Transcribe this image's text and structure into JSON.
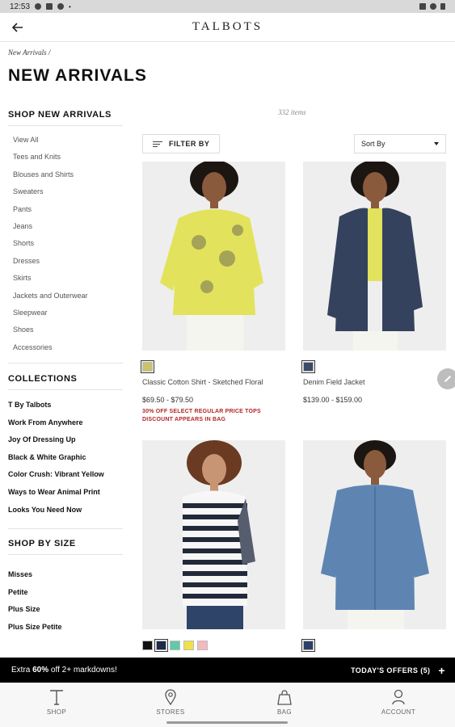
{
  "status_bar": {
    "time": "12:53"
  },
  "header": {
    "logo": "TALBOTS"
  },
  "breadcrumb": {
    "text": "New Arrivals /"
  },
  "page": {
    "title": "NEW ARRIVALS"
  },
  "sidebar": {
    "shop_heading": "SHOP NEW ARRIVALS",
    "shop_items": [
      {
        "label": "View All"
      },
      {
        "label": "Tees and Knits"
      },
      {
        "label": "Blouses and Shirts"
      },
      {
        "label": "Sweaters"
      },
      {
        "label": "Pants"
      },
      {
        "label": "Jeans"
      },
      {
        "label": "Shorts"
      },
      {
        "label": "Dresses"
      },
      {
        "label": "Skirts"
      },
      {
        "label": "Jackets and Outerwear"
      },
      {
        "label": "Sleepwear"
      },
      {
        "label": "Shoes"
      },
      {
        "label": "Accessories"
      }
    ],
    "collections_heading": "COLLECTIONS",
    "collections": [
      {
        "label": "T By Talbots"
      },
      {
        "label": "Work From Anywhere"
      },
      {
        "label": "Joy Of Dressing Up"
      },
      {
        "label": "Black & White Graphic"
      },
      {
        "label": "Color Crush: Vibrant Yellow"
      },
      {
        "label": "Ways to Wear Animal Print"
      },
      {
        "label": "Looks You Need Now"
      }
    ],
    "size_heading": "SHOP BY SIZE",
    "sizes": [
      {
        "label": "Misses"
      },
      {
        "label": "Petite"
      },
      {
        "label": "Plus Size"
      },
      {
        "label": "Plus Size Petite"
      }
    ]
  },
  "toolbar": {
    "item_count": "332 items",
    "filter_label": "FILTER BY",
    "sort_label": "Sort By"
  },
  "products": [
    {
      "name": "Classic Cotton Shirt - Sketched Floral",
      "price": "$69.50 - $79.50",
      "promo_line1": "30% OFF SELECT REGULAR PRICE TOPS",
      "promo_line2": "DISCOUNT APPEARS IN BAG",
      "swatches": [
        "#c9c46a"
      ],
      "shirt_color": "#e3e25c"
    },
    {
      "name": "Denim Field Jacket",
      "price": "$139.00 - $159.00",
      "swatches": [
        "#3b4a66"
      ],
      "shirt_color": "#34425e"
    },
    {
      "swatches": [
        "#111111",
        "#1e2a4a",
        "#5fc9a8",
        "#f0e04a",
        "#f5b8c2"
      ],
      "shirt_color": "#222a3a"
    },
    {
      "swatches": [
        "#2d4165"
      ],
      "shirt_color": "#5e85b2"
    }
  ],
  "promo_bar": {
    "pre": "Extra ",
    "bold": "60%",
    "post": " off 2+ markdowns!",
    "offers": "TODAY'S OFFERS (5)",
    "plus": "+"
  },
  "bottom_nav": [
    {
      "label": "SHOP",
      "icon": "talbots-t-icon"
    },
    {
      "label": "STORES",
      "icon": "location-pin-icon"
    },
    {
      "label": "BAG",
      "icon": "shopping-bag-icon"
    },
    {
      "label": "ACCOUNT",
      "icon": "person-icon"
    }
  ]
}
